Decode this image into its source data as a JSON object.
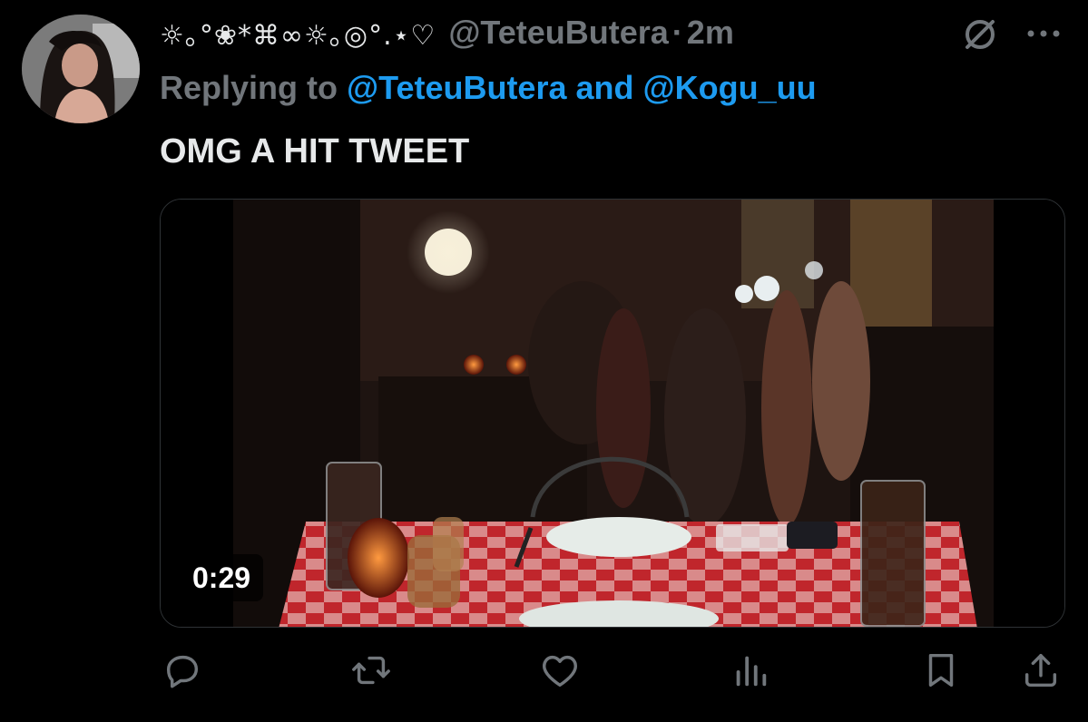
{
  "tweet": {
    "display_name": "☼｡°❀*⌘∞☼｡◎°.⋆♡",
    "handle": "@TeteuButera",
    "separator": "·",
    "timestamp": "2m",
    "replying_prefix": "Replying to",
    "reply_mention_1": "@TeteuButera",
    "reply_conjunction": "and",
    "reply_mention_2": "@Kogu_uu",
    "text": "OMG A HIT TWEET",
    "video_duration": "0:29"
  },
  "icons": {
    "header": [
      "grok-icon",
      "more-icon"
    ],
    "actions": [
      "reply-icon",
      "retweet-icon",
      "like-icon",
      "views-icon",
      "bookmark-icon",
      "share-icon"
    ]
  },
  "colors": {
    "background": "#000000",
    "primary_text": "#e7e9ea",
    "secondary_text": "#71767b",
    "mention": "#1d9bf0"
  }
}
